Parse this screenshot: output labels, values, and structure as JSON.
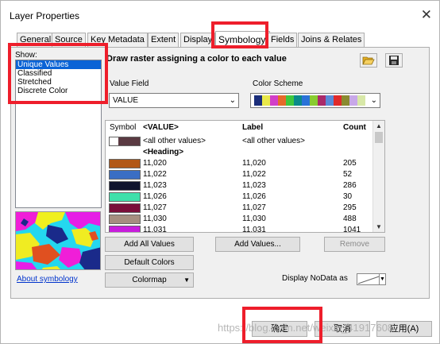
{
  "window": {
    "title": "Layer Properties",
    "close_glyph": "✕"
  },
  "tabs": [
    {
      "label": "General"
    },
    {
      "label": "Source"
    },
    {
      "label": "Key Metadata"
    },
    {
      "label": "Extent"
    },
    {
      "label": "Display"
    },
    {
      "label": "Symbology",
      "active": true
    },
    {
      "label": "Fields"
    },
    {
      "label": "Joins & Relates"
    }
  ],
  "show": {
    "label": "Show:",
    "items": [
      "Unique Values",
      "Classified",
      "Stretched",
      "Discrete Color"
    ],
    "selected": "Unique Values"
  },
  "about_link": "About symbology",
  "description": "Draw raster assigning a color to each value",
  "toolbar": {
    "open_icon": "folder-open-icon",
    "save_icon": "save-icon"
  },
  "value_field": {
    "label": "Value Field",
    "value": "VALUE"
  },
  "color_scheme": {
    "label": "Color Scheme",
    "colors": [
      "#1a2d7a",
      "#e8e84a",
      "#d23ec8",
      "#e66a2a",
      "#3ec83e",
      "#0a8a8a",
      "#2a72d8",
      "#88cc30",
      "#aa2a6a",
      "#5a8ad8",
      "#e02a2a",
      "#8a8a30",
      "#c8a8e8",
      "#d8e8a8"
    ]
  },
  "table": {
    "headers": {
      "symbol": "Symbol",
      "value": "<VALUE>",
      "label": "Label",
      "count": "Count"
    },
    "other": {
      "value": "<all other values>",
      "label": "<all other values>",
      "colors": [
        "#ffffff",
        "#5a3a42"
      ]
    },
    "heading": "<Heading>",
    "rows": [
      {
        "value": "11,020",
        "label": "11,020",
        "count": "205",
        "color": "#b25817"
      },
      {
        "value": "11,022",
        "label": "11,022",
        "count": "52",
        "color": "#3a6ec4"
      },
      {
        "value": "11,023",
        "label": "11,023",
        "count": "286",
        "color": "#10142e"
      },
      {
        "value": "11,026",
        "label": "11,026",
        "count": "30",
        "color": "#3ee0aa"
      },
      {
        "value": "11,027",
        "label": "11,027",
        "count": "295",
        "color": "#7a0e3a"
      },
      {
        "value": "11,030",
        "label": "11,030",
        "count": "488",
        "color": "#a68e80"
      },
      {
        "value": "11,031",
        "label": "11,031",
        "count": "1041",
        "color": "#c81edc"
      }
    ]
  },
  "buttons": {
    "add_all": "Add All Values",
    "add_values": "Add Values...",
    "remove": "Remove",
    "default_colors": "Default Colors",
    "colormap": "Colormap"
  },
  "nodata": {
    "label": "Display NoData as"
  },
  "footer": {
    "ok": "确定",
    "cancel": "取消",
    "apply": "应用(A)"
  },
  "watermark": "https://blog.csdn.net/weixin_41917608"
}
